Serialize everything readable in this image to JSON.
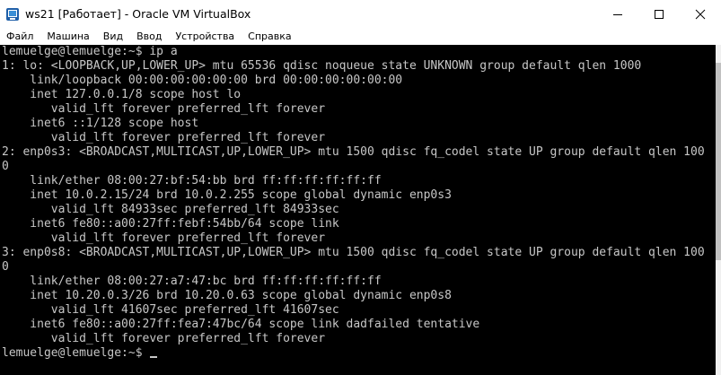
{
  "window": {
    "title": "ws21 [Работает] - Oracle VM VirtualBox",
    "app_icon": "virtualbox-icon",
    "controls": {
      "minimize_icon": "minimize-icon",
      "maximize_icon": "maximize-icon",
      "close_icon": "close-icon"
    }
  },
  "menu": {
    "items": [
      "Файл",
      "Машина",
      "Вид",
      "Ввод",
      "Устройства",
      "Справка"
    ]
  },
  "terminal": {
    "lines": [
      "lemuelge@lemuelge:~$ ip a",
      "1: lo: <LOOPBACK,UP,LOWER_UP> mtu 65536 qdisc noqueue state UNKNOWN group default qlen 1000",
      "    link/loopback 00:00:00:00:00:00 brd 00:00:00:00:00:00",
      "    inet 127.0.0.1/8 scope host lo",
      "       valid_lft forever preferred_lft forever",
      "    inet6 ::1/128 scope host",
      "       valid_lft forever preferred_lft forever",
      "2: enp0s3: <BROADCAST,MULTICAST,UP,LOWER_UP> mtu 1500 qdisc fq_codel state UP group default qlen 100",
      "0",
      "    link/ether 08:00:27:bf:54:bb brd ff:ff:ff:ff:ff:ff",
      "    inet 10.0.2.15/24 brd 10.0.2.255 scope global dynamic enp0s3",
      "       valid_lft 84933sec preferred_lft 84933sec",
      "    inet6 fe80::a00:27ff:febf:54bb/64 scope link",
      "       valid_lft forever preferred_lft forever",
      "3: enp0s8: <BROADCAST,MULTICAST,UP,LOWER_UP> mtu 1500 qdisc fq_codel state UP group default qlen 100",
      "0",
      "    link/ether 08:00:27:a7:47:bc brd ff:ff:ff:ff:ff:ff",
      "    inet 10.20.0.3/26 brd 10.20.0.63 scope global dynamic enp0s8",
      "       valid_lft 41607sec preferred_lft 41607sec",
      "    inet6 fe80::a00:27ff:fea7:47bc/64 scope link dadfailed tentative",
      "       valid_lft forever preferred_lft forever"
    ],
    "prompt": "lemuelge@lemuelge:~$ "
  },
  "colors": {
    "terminal_bg": "#000000",
    "terminal_fg": "#c7c7c7",
    "titlebar_bg": "#ffffff"
  }
}
